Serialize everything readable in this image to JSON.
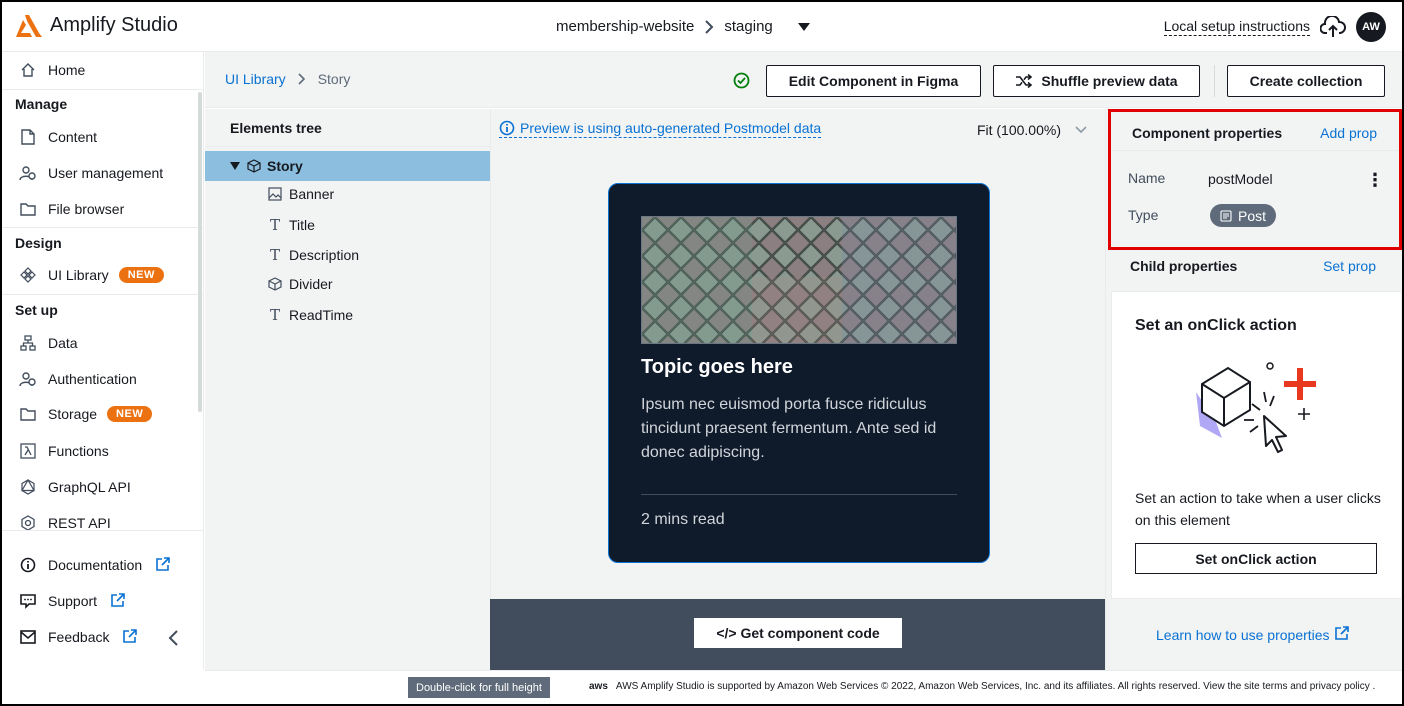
{
  "app": {
    "name": "Amplify Studio"
  },
  "topbar": {
    "app_name": "membership-website",
    "environment": "staging",
    "local_setup": "Local setup instructions",
    "avatar_initials": "AW"
  },
  "sidebar": {
    "home": "Home",
    "sections": {
      "manage": "Manage",
      "design": "Design",
      "setup": "Set up"
    },
    "manage_items": [
      "Content",
      "User management",
      "File browser"
    ],
    "design_items": [
      "UI Library"
    ],
    "setup_items": [
      "Data",
      "Authentication",
      "Storage",
      "Functions",
      "GraphQL API",
      "REST API"
    ],
    "new_badge": "NEW",
    "bottom_items": [
      "Documentation",
      "Support",
      "Feedback"
    ]
  },
  "breadcrumb": {
    "parent": "UI Library",
    "current": "Story"
  },
  "toolbar": {
    "edit_figma": "Edit Component in Figma",
    "shuffle": "Shuffle preview data",
    "create_collection": "Create collection"
  },
  "tree": {
    "heading": "Elements tree",
    "root": "Story",
    "children": [
      "Banner",
      "Title",
      "Description",
      "Divider",
      "ReadTime"
    ]
  },
  "canvas": {
    "info": "Preview is using auto-generated Postmodel data",
    "zoom": "Fit (100.00%)"
  },
  "preview_card": {
    "title": "Topic goes here",
    "description": "Ipsum nec euismod porta fusce ridiculus tincidunt praesent fermentum. Ante sed id donec adipiscing.",
    "read_time": "2 mins read"
  },
  "code_button": "</> Get component code",
  "component_properties": {
    "heading": "Component properties",
    "add_prop": "Add prop",
    "name_label": "Name",
    "name_value": "postModel",
    "type_label": "Type",
    "type_value": "Post"
  },
  "child_properties": {
    "heading": "Child properties",
    "set_prop": "Set prop",
    "onclick_title": "Set an onClick action",
    "onclick_desc": "Set an action to take when a user clicks on this element",
    "onclick_button": "Set onClick action"
  },
  "learn_link": "Learn how to use properties",
  "footer": {
    "tooltip": "Double-click for full height",
    "aws_logo": "aws",
    "text": "AWS Amplify Studio is supported by Amazon Web Services © 2022, Amazon Web Services, Inc. and its affiliates. All rights reserved. View the site terms and privacy policy ."
  },
  "colors": {
    "accent": "#0972d3",
    "brand_orange": "#ec7211",
    "highlight_border": "#e00000",
    "tree_selected": "#8cbfdf",
    "card_bg": "#0f1b2a"
  }
}
